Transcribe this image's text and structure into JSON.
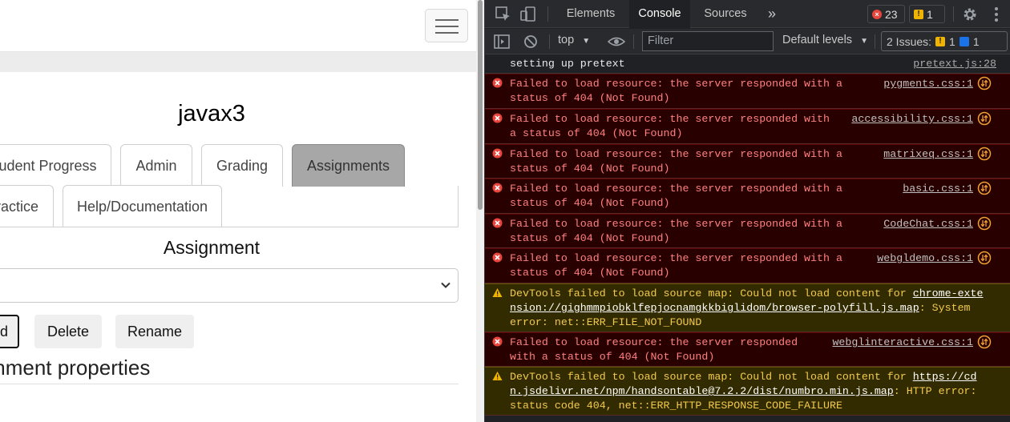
{
  "page": {
    "course_title": "javax3",
    "tabs_row1": [
      "udent Progress",
      "Admin",
      "Grading",
      "Assignments"
    ],
    "tabs_row2": [
      "ractice",
      "Help/Documentation"
    ],
    "active_tab": "Assignments",
    "assignment_label": "Assignment",
    "buttons": {
      "add": "d",
      "delete": "Delete",
      "rename": "Rename"
    },
    "properties_heading": "ignment properties"
  },
  "devtools": {
    "tabs": [
      "Elements",
      "Console",
      "Sources"
    ],
    "active_tab": "Console",
    "more": "»",
    "error_count": "23",
    "warning_count": "1",
    "toolbar": {
      "context": "top",
      "filter_placeholder": "Filter",
      "levels": "Default levels",
      "issues_label": "2 Issues:",
      "issues_warn": "1",
      "issues_info": "1"
    },
    "messages": [
      {
        "level": "log",
        "lines": [
          "setting up pretext"
        ],
        "source": "pretext.js:28"
      },
      {
        "level": "error",
        "lines": [
          "Failed to load resource: the server responded with a",
          "status of 404 (Not Found)"
        ],
        "source": "pygments.css:1"
      },
      {
        "level": "error",
        "lines": [
          "Failed to load resource: the server responded with",
          "a status of 404 (Not Found)"
        ],
        "source": "accessibility.css:1"
      },
      {
        "level": "error",
        "lines": [
          "Failed to load resource: the server responded with a",
          "status of 404 (Not Found)"
        ],
        "source": "matrixeq.css:1"
      },
      {
        "level": "error",
        "lines": [
          "Failed to load resource: the server responded with a",
          "status of 404 (Not Found)"
        ],
        "source": "basic.css:1"
      },
      {
        "level": "error",
        "lines": [
          "Failed to load resource: the server responded with a",
          "status of 404 (Not Found)"
        ],
        "source": "CodeChat.css:1"
      },
      {
        "level": "error",
        "lines": [
          "Failed to load resource: the server responded with a",
          "status of 404 (Not Found)"
        ],
        "source": "webgldemo.css:1"
      },
      {
        "level": "warning",
        "prefix": "DevTools failed to load source map: Could not load content for ",
        "link1": "chrome-exte",
        "link2": "nsion://gighmmpiobklfepjocnamgkkbiglidom/browser-polyfill.js.map",
        "suffix2": ": System",
        "line3": "error: net::ERR_FILE_NOT_FOUND"
      },
      {
        "level": "error",
        "lines": [
          "Failed to load resource: the server responded",
          "with a status of 404 (Not Found)"
        ],
        "source": "webglinteractive.css:1"
      },
      {
        "level": "warning",
        "prefix": "DevTools failed to load source map: Could not load content for ",
        "link1": "https://cd",
        "link2": "n.jsdelivr.net/npm/handsontable@7.2.2/dist/numbro.min.js.map",
        "suffix2": ": HTTP error:",
        "line3": "status code 404, net::ERR_HTTP_RESPONSE_CODE_FAILURE"
      }
    ]
  }
}
